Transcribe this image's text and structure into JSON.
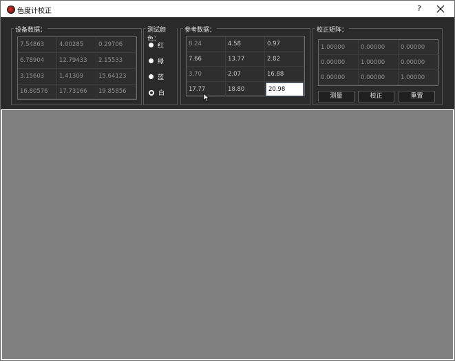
{
  "window": {
    "title": "色度计校正",
    "help_label": "?"
  },
  "device_data": {
    "title": "设备数据：",
    "rows": [
      [
        "7.54863",
        "4.00285",
        "0.29706"
      ],
      [
        "6.78904",
        "12.79433",
        "2.15533"
      ],
      [
        "3.15603",
        "1.41309",
        "15.64123"
      ],
      [
        "16.80576",
        "17.73166",
        "19.85856"
      ]
    ]
  },
  "test_color": {
    "title": "测试颜色：",
    "options": [
      "红",
      "绿",
      "蓝",
      "白"
    ],
    "selected": "白"
  },
  "reference_data": {
    "title": "参考数据：",
    "rows": [
      [
        "8.24",
        "4.58",
        "0.97"
      ],
      [
        "7.66",
        "13.77",
        "2.82"
      ],
      [
        "3.70",
        "2.07",
        "16.88"
      ],
      [
        "17.77",
        "18.80",
        "20.98"
      ]
    ]
  },
  "calibration_matrix": {
    "title": "校正矩阵：",
    "rows": [
      [
        "1.00000",
        "0.00000",
        "0.00000"
      ],
      [
        "0.00000",
        "1.00000",
        "0.00000"
      ],
      [
        "0.00000",
        "0.00000",
        "1.00000"
      ]
    ],
    "buttons": {
      "measure": "测量",
      "calibrate": "校正",
      "reset": "重置"
    }
  },
  "colors": {
    "toolbar_bg": "#2a2a2a",
    "workspace_bg": "#808080"
  }
}
